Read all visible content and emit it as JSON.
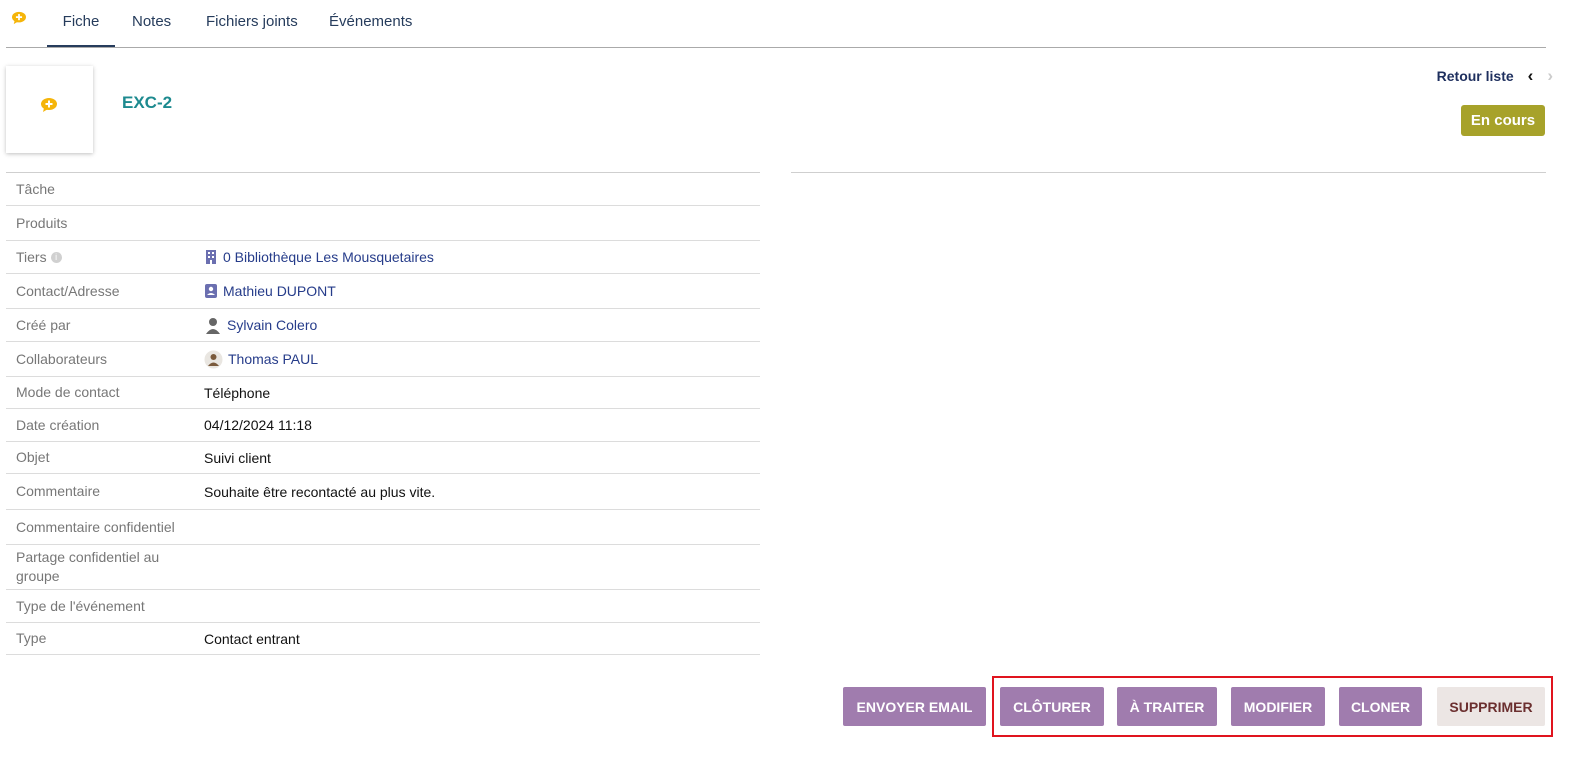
{
  "tabs": [
    {
      "label": "Fiche",
      "active": true
    },
    {
      "label": "Notes",
      "active": false
    },
    {
      "label": "Fichiers joints",
      "active": false
    },
    {
      "label": "Événements",
      "active": false
    }
  ],
  "header": {
    "ref": "EXC-2",
    "back_label": "Retour liste",
    "status": "En cours",
    "status_color": "#a7a22a"
  },
  "fields": [
    {
      "label": "Tâche",
      "value": ""
    },
    {
      "label": "Produits",
      "value": ""
    },
    {
      "label": "Tiers",
      "value": "0 Bibliothèque Les Mousquetaires",
      "icon": "building-icon"
    },
    {
      "label": "Contact/Adresse",
      "value": "Mathieu DUPONT",
      "icon": "contact-card-icon"
    },
    {
      "label": "Créé par",
      "value": "Sylvain Colero",
      "icon": "user-icon"
    },
    {
      "label": "Collaborateurs",
      "value": "Thomas PAUL",
      "icon": "user-avatar-icon"
    },
    {
      "label": "Mode de contact",
      "value": "Téléphone"
    },
    {
      "label": "Date création",
      "value": "04/12/2024 11:18"
    },
    {
      "label": "Objet",
      "value": "Suivi client"
    },
    {
      "label": "Commentaire",
      "value": "Souhaite être recontacté au plus vite."
    },
    {
      "label": "Commentaire confidentiel",
      "value": ""
    },
    {
      "label": "Partage confidentiel au groupe",
      "value": ""
    },
    {
      "label": "Type de l'événement",
      "value": ""
    },
    {
      "label": "Type",
      "value": "Contact entrant"
    }
  ],
  "actions": {
    "email": "ENVOYER EMAIL",
    "cloturer": "CLÔTURER",
    "traiter": "À TRAITER",
    "modifier": "MODIFIER",
    "cloner": "CLONER",
    "supprimer": "SUPPRIMER"
  },
  "colors": {
    "accent_purple": "#a07cae",
    "ref_teal": "#1d8a8f",
    "highlight_frame": "#e0141e"
  }
}
